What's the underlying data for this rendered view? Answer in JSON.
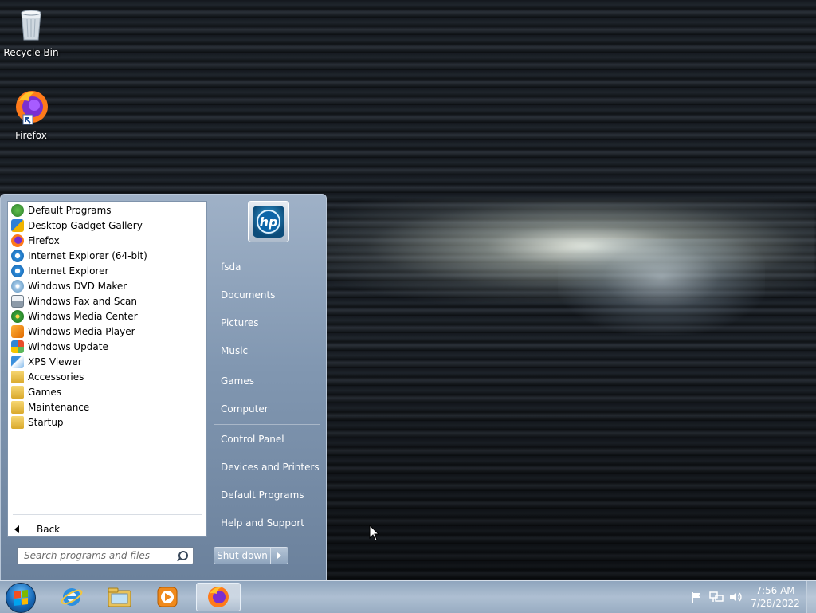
{
  "desktop": {
    "icons": [
      {
        "label": "Recycle Bin",
        "icon": "recycle-bin-icon"
      },
      {
        "label": "Firefox",
        "icon": "firefox-icon"
      }
    ]
  },
  "start_menu": {
    "programs": [
      {
        "label": "Default Programs",
        "icon": "default-programs-icon"
      },
      {
        "label": "Desktop Gadget Gallery",
        "icon": "gadget-gallery-icon"
      },
      {
        "label": "Firefox",
        "icon": "firefox-icon"
      },
      {
        "label": "Internet Explorer (64-bit)",
        "icon": "internet-explorer-icon"
      },
      {
        "label": "Internet Explorer",
        "icon": "internet-explorer-icon"
      },
      {
        "label": "Windows DVD Maker",
        "icon": "dvd-maker-icon"
      },
      {
        "label": "Windows Fax and Scan",
        "icon": "fax-scan-icon"
      },
      {
        "label": "Windows Media Center",
        "icon": "media-center-icon"
      },
      {
        "label": "Windows Media Player",
        "icon": "media-player-icon"
      },
      {
        "label": "Windows Update",
        "icon": "windows-update-icon"
      },
      {
        "label": "XPS Viewer",
        "icon": "xps-viewer-icon"
      },
      {
        "label": "Accessories",
        "icon": "folder-icon"
      },
      {
        "label": "Games",
        "icon": "folder-icon"
      },
      {
        "label": "Maintenance",
        "icon": "folder-icon"
      },
      {
        "label": "Startup",
        "icon": "folder-icon"
      }
    ],
    "back_label": "Back",
    "search_placeholder": "Search programs and files",
    "right_items": [
      {
        "label": "fsda"
      },
      {
        "label": "Documents"
      },
      {
        "label": "Pictures"
      },
      {
        "label": "Music"
      },
      {
        "label": "Games"
      },
      {
        "label": "Computer"
      },
      {
        "label": "Control Panel"
      },
      {
        "label": "Devices and Printers"
      },
      {
        "label": "Default Programs"
      },
      {
        "label": "Help and Support"
      }
    ],
    "user_picture_text": "hp",
    "shutdown_label": "Shut down"
  },
  "taskbar": {
    "pinned": [
      {
        "icon": "internet-explorer-icon"
      },
      {
        "icon": "windows-explorer-icon"
      },
      {
        "icon": "media-player-icon"
      },
      {
        "icon": "firefox-icon",
        "active": true
      }
    ],
    "tray_icons": [
      "action-center-flag-icon",
      "network-icon",
      "volume-icon"
    ],
    "time": "7:56 AM",
    "date": "7/28/2022"
  },
  "colors": {
    "startmenu_bg": "#8197b1",
    "taskbar_bg": "#aebfd2",
    "accent_blue": "#1769b8"
  }
}
